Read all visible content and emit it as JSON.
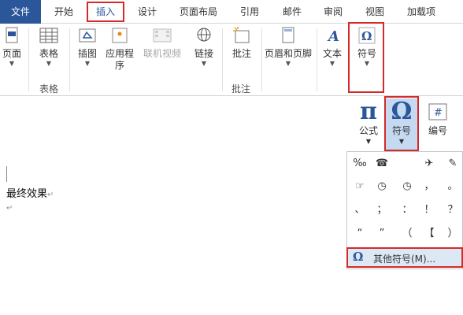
{
  "tabs": {
    "file": "文件",
    "home": "开始",
    "insert": "插入",
    "design": "设计",
    "layout": "页面布局",
    "references": "引用",
    "mailings": "邮件",
    "review": "审阅",
    "view": "视图",
    "addins": "加载项"
  },
  "ribbon": {
    "pages": "页面",
    "table": "表格",
    "table_group": "表格",
    "illustrations": "插图",
    "apps": "应用程",
    "apps2": "序",
    "online_video": "联机视频",
    "links": "链接",
    "comment": "批注",
    "comment_group": "批注",
    "header_footer": "页眉和页脚",
    "text": "文本",
    "symbols": "符号",
    "equation": "公式",
    "symbol": "符号",
    "number": "编号"
  },
  "document": {
    "text": "最终效果",
    "return_mark": "↵",
    "para_mark": "↵"
  },
  "gallery": {
    "rows": [
      [
        "‰",
        "☎",
        "",
        "✈",
        "✎"
      ],
      [
        "☞",
        "◷",
        "◷",
        "，",
        "。"
      ],
      [
        "、",
        "；",
        "：",
        "！",
        "？"
      ],
      [
        "“",
        "”",
        "（",
        "【",
        "）"
      ]
    ],
    "more_label": "其他符号(M)...",
    "more_icon": "Ω"
  },
  "colors": {
    "accent": "#2b579a",
    "highlight": "#d42a2a",
    "selected_bg": "#c5d9f1"
  }
}
